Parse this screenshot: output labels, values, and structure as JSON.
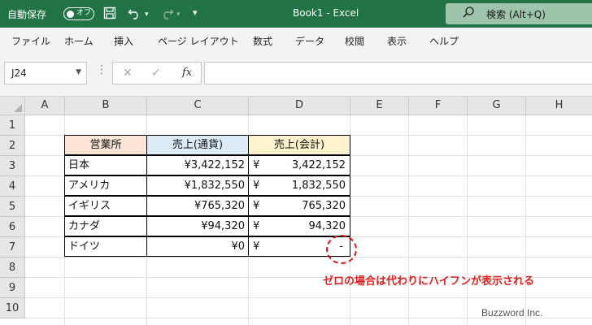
{
  "titlebar": {
    "autosave_label": "自動保存",
    "autosave_state": "オフ",
    "save_icon": "save-icon",
    "undo_icon": "undo-icon",
    "redo_icon": "redo-icon",
    "customize_icon": "customize-qat-icon",
    "title": "Book1  -  Excel",
    "search_icon": "search-icon",
    "search_placeholder": "検索 (Alt+Q)",
    "bg_color": "#217346"
  },
  "ribbon": {
    "tabs": [
      "ファイル",
      "ホーム",
      "挿入",
      "ページ レイアウト",
      "数式",
      "データ",
      "校閲",
      "表示",
      "ヘルプ"
    ]
  },
  "formula_bar": {
    "name_box": "J24",
    "cancel_icon": "cancel-x-icon",
    "enter_icon": "enter-check-icon",
    "fx_label": "fx",
    "formula": ""
  },
  "grid": {
    "columns": [
      "A",
      "B",
      "C",
      "D",
      "E",
      "F",
      "G",
      "H"
    ],
    "rows": [
      "1",
      "2",
      "3",
      "4",
      "5",
      "6",
      "7",
      "8",
      "9",
      "10"
    ]
  },
  "table": {
    "headers": [
      "営業所",
      "売上(通貨)",
      "売上(会計)"
    ],
    "header_colors": [
      "#fce4d6",
      "#ddebf7",
      "#fff2cc"
    ],
    "rows": [
      {
        "office": "日本",
        "currency": "¥3,422,152",
        "acc_symbol": "¥",
        "acc_value": "3,422,152"
      },
      {
        "office": "アメリカ",
        "currency": "¥1,832,550",
        "acc_symbol": "¥",
        "acc_value": "1,832,550"
      },
      {
        "office": "イギリス",
        "currency": "¥765,320",
        "acc_symbol": "¥",
        "acc_value": "765,320"
      },
      {
        "office": "カナダ",
        "currency": "¥94,320",
        "acc_symbol": "¥",
        "acc_value": "94,320"
      },
      {
        "office": "ドイツ",
        "currency": "¥0",
        "acc_symbol": "¥",
        "acc_value": "-"
      }
    ]
  },
  "annotation": {
    "note": "ゼロの場合は代わりにハイフンが表示される",
    "color": "#e0201d"
  },
  "watermark": "Buzzword Inc."
}
